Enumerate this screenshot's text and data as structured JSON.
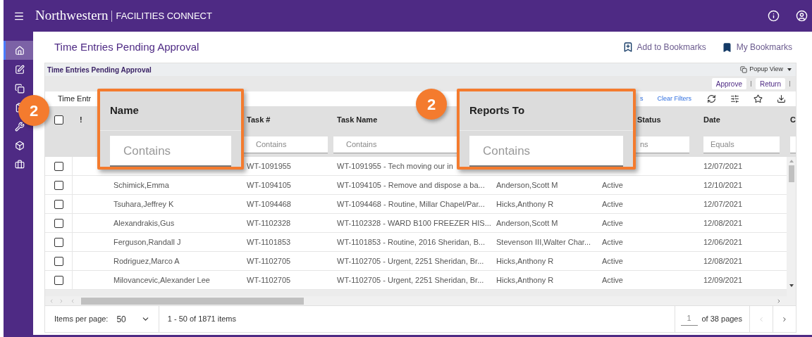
{
  "app_bar": {
    "brand": "Northwestern",
    "product": "FACILITIES CONNECT"
  },
  "sidebar": {
    "items": [
      {
        "selected": true
      },
      {
        "selected": false
      },
      {
        "selected": false
      },
      {
        "selected": false
      },
      {
        "selected": false
      },
      {
        "selected": false
      },
      {
        "selected": false
      }
    ]
  },
  "page": {
    "title": "Time Entries Pending Approval",
    "actions": [
      "Add to Bookmarks",
      "My Bookmarks"
    ]
  },
  "panel": {
    "title": "Time Entries Pending Approval",
    "popup_view": "Popup View",
    "buttons": [
      "Approve",
      "Return"
    ],
    "grid_title": "Time Entr",
    "toolbar_fragment": "s",
    "clear_filters": "Clear Filters"
  },
  "table": {
    "select_all_checked": false,
    "header": {
      "flag": "!",
      "task_no": "Task #",
      "task_name": "Task Name",
      "status": "Status",
      "date": "Date",
      "column_9": "C"
    },
    "filters": {
      "task_no": "Contains",
      "task_name": "Contains",
      "status": "ns",
      "date": "Equals"
    },
    "rows": [
      {
        "checked": false,
        "task_no": "WT-1091955",
        "task_name": "WT-1091955 - Tech moving our in",
        "date": "12/07/2021"
      },
      {
        "checked": false,
        "name": "Schimick,Emma",
        "task_no": "WT-1094105",
        "task_name": "WT-1094105 - Remove and dispose a ba...",
        "reports_to": "Anderson,Scott M",
        "status": "Active",
        "date": "12/10/2021"
      },
      {
        "checked": false,
        "name": "Tsuhara,Jeffrey K",
        "task_no": "WT-1094468",
        "task_name": "WT-1094468 - Routine, Millar Chapel/Par...",
        "reports_to": "Hicks,Anthony R",
        "status": "Active",
        "date": "12/07/2021"
      },
      {
        "checked": false,
        "name": "Alexandrakis,Gus",
        "task_no": "WT-1102328",
        "task_name": "WT-1102328 - WARD B100 FREEZER HIS...",
        "reports_to": "Anderson,Scott M",
        "status": "Active",
        "date": "12/08/2021"
      },
      {
        "checked": false,
        "name": "Ferguson,Randall J",
        "task_no": "WT-1101853",
        "task_name": "WT-1101853 - Routine, 2016 Sheridan, B...",
        "reports_to": "Stevenson III,Walter Char...",
        "status": "Active",
        "date": "12/06/2021"
      },
      {
        "checked": false,
        "name": "Rodriguez,Marco A",
        "task_no": "WT-1102705",
        "task_name": "WT-1102705 - Urgent, 2251 Sheridan, Br...",
        "reports_to": "Hicks,Anthony R",
        "status": "Active",
        "date": "12/08/2021"
      },
      {
        "checked": false,
        "name": "Milovancevic,Alexander Lee",
        "task_no": "WT-1102705",
        "task_name": "WT-1102705 - Urgent, 2251 Sheridan, Br...",
        "reports_to": "Hicks,Anthony R",
        "status": "Active",
        "date": "12/09/2021"
      }
    ]
  },
  "footer": {
    "items_per_page_label": "Items per page:",
    "items_per_page": "50",
    "range": "1 - 50 of 1871 items",
    "page": "1",
    "pages": "of 38 pages"
  },
  "callouts": [
    {
      "number": "2",
      "label": "Name",
      "placeholder": "Contains"
    },
    {
      "number": "2",
      "label": "Reports To",
      "placeholder": "Contains"
    }
  ]
}
